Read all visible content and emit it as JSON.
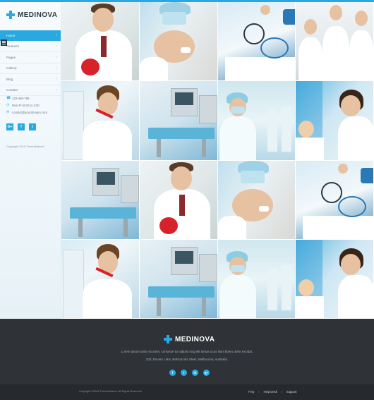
{
  "brand": {
    "name": "MEDINOVA"
  },
  "sidebar": {
    "nav": [
      {
        "label": "Home",
        "active": true
      },
      {
        "label": "Features",
        "active": false
      },
      {
        "label": "Pages",
        "active": false
      },
      {
        "label": "Gallery",
        "active": false
      },
      {
        "label": "Blog",
        "active": false
      },
      {
        "label": "Contact",
        "active": false
      }
    ],
    "contact": {
      "phone": "123-456-789",
      "hours": "Mon-Fri 8:00 to 2:00",
      "email": "contact@yourdomain.com"
    },
    "social": [
      "G+",
      "f",
      "t"
    ],
    "copyright": "Copyright 2016 ThemeMascot"
  },
  "gallery": {
    "tiles": [
      "doctor-heart",
      "dentist",
      "stethoscope",
      "medical-team",
      "nurse-lab",
      "operating-room",
      "hospital-corridor",
      "child-dentist",
      "operating-room",
      "doctor-heart",
      "dentist",
      "stethoscope",
      "nurse-lab",
      "operating-room",
      "hospital-corridor",
      "child-dentist"
    ]
  },
  "footer": {
    "brand": "MEDINOVA",
    "description": "Lorem ipsum dolor sit amet, consecte tur adipisi cing elit lorkas ucus illum libero dolor excidat.",
    "address": "203, Envato Labs, Behind Alis Steet, Melbourne, Australia.",
    "social": [
      "f",
      "t",
      "in",
      "g+"
    ],
    "copyright": "Copyright ©2016 ThemeMascot. All Rights Reserved",
    "links": [
      "FAQ",
      "Help Desk",
      "Support"
    ]
  },
  "colors": {
    "accent": "#29a9df",
    "footer_bg": "#2f3338",
    "bottom_bg": "#262a2e"
  }
}
